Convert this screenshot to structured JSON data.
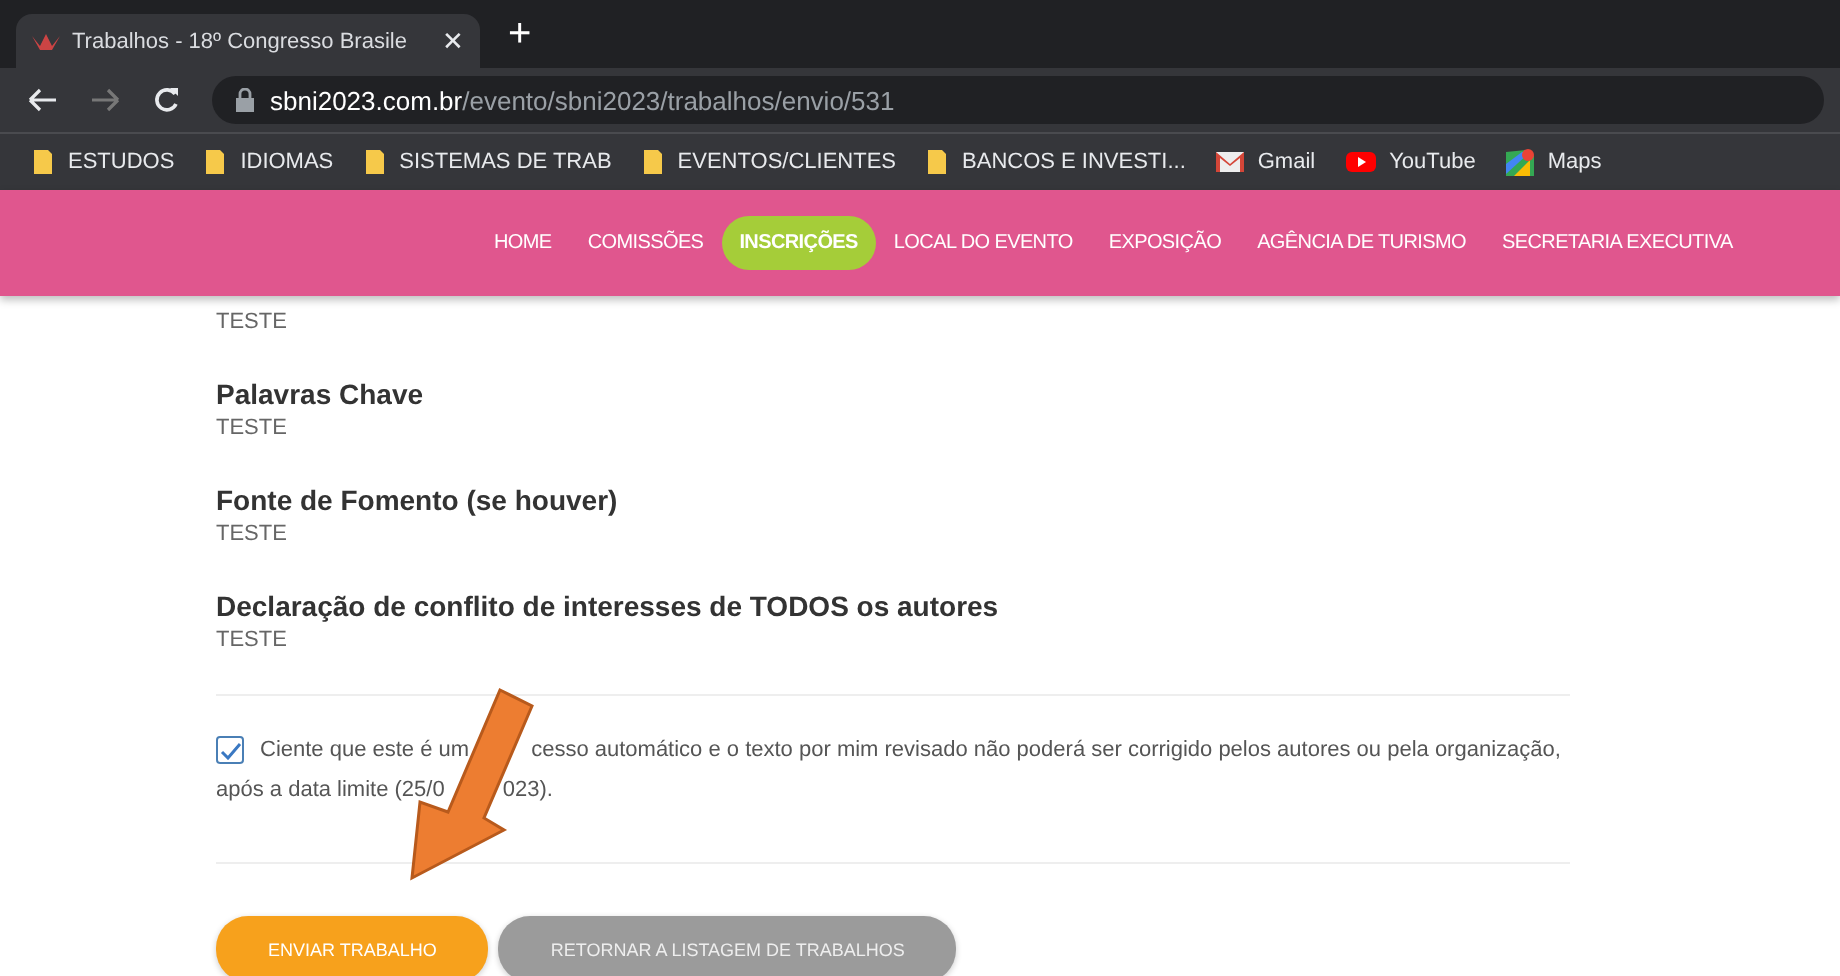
{
  "browser": {
    "tab": {
      "title": "Trabalhos - 18º Congresso Brasile",
      "close": "✕"
    },
    "new_tab": "+",
    "address": {
      "host": "sbni2023.com.br",
      "path": "/evento/sbni2023/trabalhos/envio/531"
    },
    "bookmarks": [
      {
        "kind": "folder",
        "label": "ESTUDOS"
      },
      {
        "kind": "folder",
        "label": "IDIOMAS"
      },
      {
        "kind": "folder",
        "label": "SISTEMAS DE TRAB"
      },
      {
        "kind": "folder",
        "label": "EVENTOS/CLIENTES"
      },
      {
        "kind": "folder",
        "label": "BANCOS E INVESTI..."
      },
      {
        "kind": "mail",
        "label": "Gmail"
      },
      {
        "kind": "video",
        "label": "YouTube"
      },
      {
        "kind": "map",
        "label": "Maps"
      }
    ]
  },
  "nav": [
    {
      "label": "HOME",
      "selected": false
    },
    {
      "label": "COMISSÕES",
      "selected": false
    },
    {
      "label": "INSCRIÇÕES",
      "selected": true
    },
    {
      "label": "LOCAL DO EVENTO",
      "selected": false
    },
    {
      "label": "EXPOSIÇÃO",
      "selected": false
    },
    {
      "label": "AGÊNCIA DE TURISMO",
      "selected": false
    },
    {
      "label": "SECRETARIA EXECUTIVA",
      "selected": false
    }
  ],
  "fields": [
    {
      "value": "TESTE"
    },
    {
      "label": "Palavras Chave",
      "value": "TESTE"
    },
    {
      "label": "Fonte de Fomento (se houver)",
      "value": "TESTE"
    },
    {
      "label": "Declaração de conflito de interesses de TODOS os autores",
      "value": "TESTE"
    }
  ],
  "agreement": {
    "checked": true,
    "lines": [
      [
        "Ciente que este é um",
        "cesso automático e o texto por mim revisado não poderá ser corrigido pelos autores ou pela organização,"
      ],
      [
        "após a data limite (25/0",
        "023)."
      ]
    ]
  },
  "buttons": [
    {
      "kind": "primary",
      "label": "ENVIAR TRABALHO"
    },
    {
      "kind": "secondary",
      "label": "RETORNAR A LISTAGEM DE TRABALHOS"
    }
  ]
}
